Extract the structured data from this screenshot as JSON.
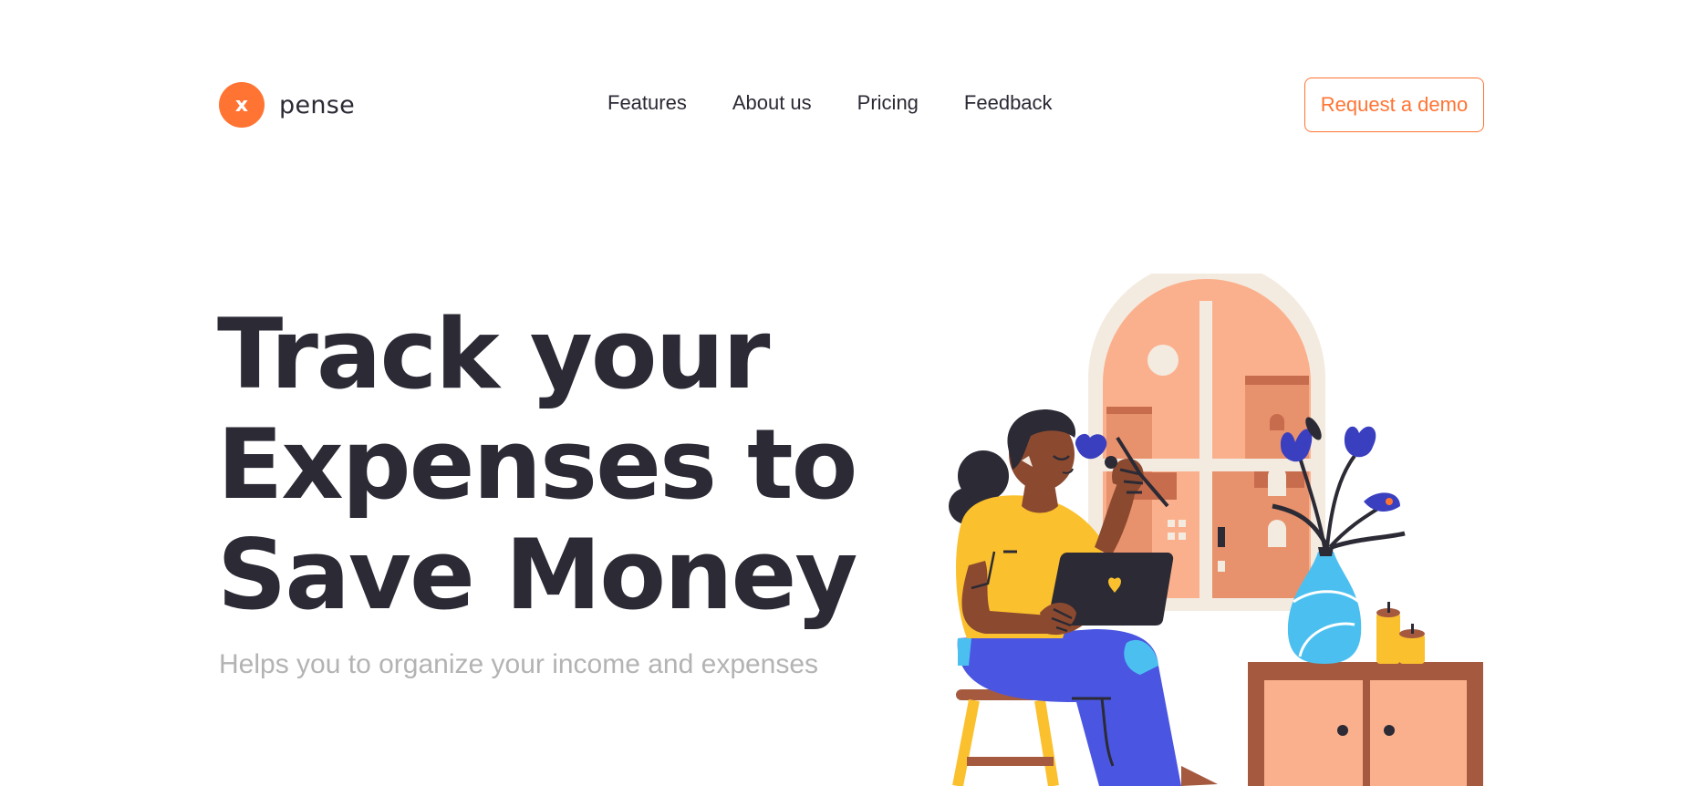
{
  "header": {
    "logo_mark": "x",
    "logo_text": "pense",
    "nav": [
      "Features",
      "About us",
      "Pricing",
      "Feedback"
    ],
    "cta_label": "Request a demo"
  },
  "hero": {
    "title_lines": [
      "Track your",
      "Expenses to",
      "Save Money"
    ],
    "subtitle": "Helps you to organize your income and expenses"
  },
  "colors": {
    "accent": "#ff7433",
    "text_dark": "#2b2a35",
    "text_muted": "#b3b3b3"
  }
}
